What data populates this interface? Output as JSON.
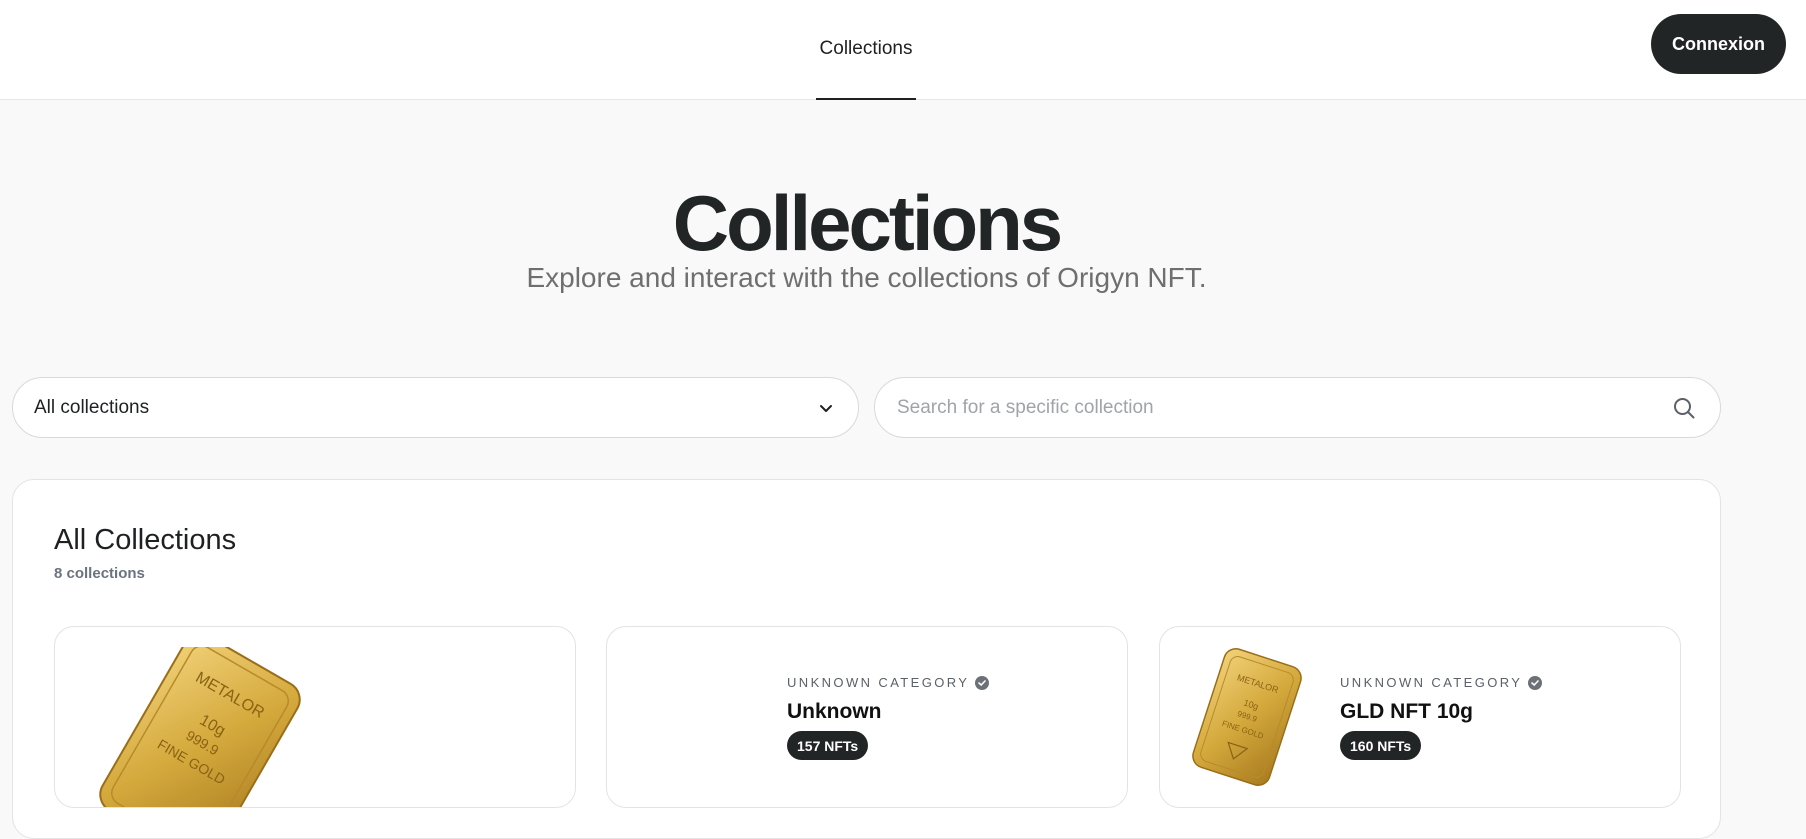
{
  "header": {
    "nav_tab": "Collections",
    "login_label": "Connexion"
  },
  "hero": {
    "title": "Collections",
    "subtitle": "Explore and interact with the collections of Origyn NFT."
  },
  "filters": {
    "select_value": "All collections",
    "search_placeholder": "Search for a specific collection"
  },
  "panel": {
    "title": "All Collections",
    "count": "8 collections"
  },
  "cards": [
    {
      "category": "",
      "name": "",
      "badge": "",
      "image": "gold-bar"
    },
    {
      "category": "UNKNOWN CATEGORY",
      "name": "Unknown",
      "badge": "157 NFTs",
      "image": "none"
    },
    {
      "category": "UNKNOWN CATEGORY",
      "name": "GLD NFT 10g",
      "badge": "160 NFTs",
      "image": "gold-bar"
    }
  ],
  "goldbar": {
    "brand": "METALOR",
    "weight": "10g",
    "purity": "999.9",
    "grade": "FINE GOLD"
  },
  "colors": {
    "accent": "#222526",
    "gold": "#d4a93c"
  }
}
